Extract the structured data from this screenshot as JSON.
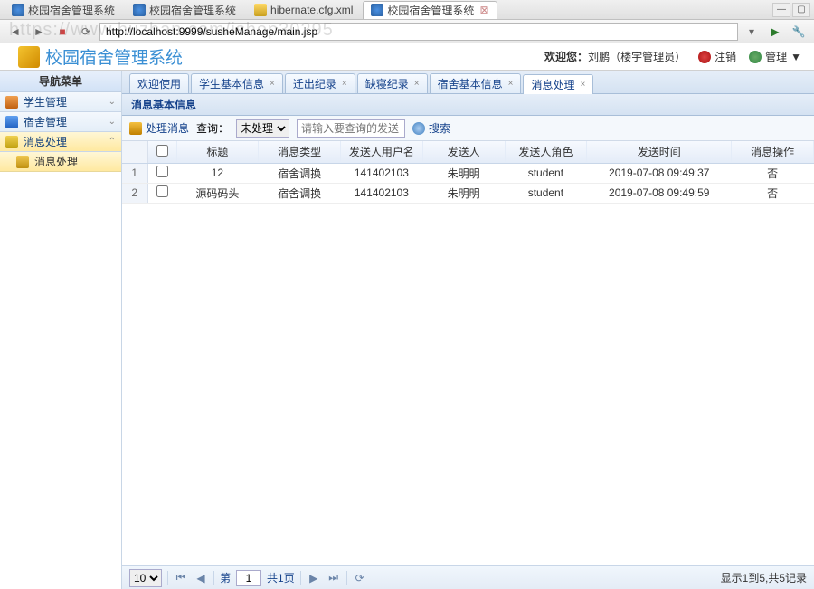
{
  "browser": {
    "tabs": [
      {
        "label": "校园宿舍管理系统",
        "icon": "globe",
        "active": false
      },
      {
        "label": "校园宿舍管理系统",
        "icon": "globe",
        "active": false
      },
      {
        "label": "hibernate.cfg.xml",
        "icon": "file",
        "active": false
      },
      {
        "label": "校园宿舍管理系统",
        "icon": "globe",
        "active": true
      }
    ],
    "address": "http://localhost:9999/susheManage/main.jsp",
    "watermark": "https://www.huzhan.com/ishop30295"
  },
  "header": {
    "app_title": "校园宿舍管理系统",
    "welcome_prefix": "欢迎您：",
    "welcome_user": "刘鹏（楼宇管理员）",
    "logout": "注销",
    "manage": "管理",
    "manage_dropdown": "▼"
  },
  "sidebar": {
    "title": "导航菜单",
    "items": [
      {
        "label": "学生管理",
        "icon": "stud",
        "active": false
      },
      {
        "label": "宿舍管理",
        "icon": "dorm",
        "active": false
      },
      {
        "label": "消息处理",
        "icon": "msg",
        "active": true
      }
    ],
    "subitem": {
      "label": "消息处理",
      "icon": "env"
    }
  },
  "tabs": [
    {
      "label": "欢迎使用",
      "closable": false,
      "active": false
    },
    {
      "label": "学生基本信息",
      "closable": true,
      "active": false
    },
    {
      "label": "迁出纪录",
      "closable": true,
      "active": false
    },
    {
      "label": "缺寝纪录",
      "closable": true,
      "active": false
    },
    {
      "label": "宿舍基本信息",
      "closable": true,
      "active": false
    },
    {
      "label": "消息处理",
      "closable": true,
      "active": true
    }
  ],
  "section": {
    "title": "消息基本信息"
  },
  "toolbar": {
    "process_label": "处理消息",
    "query_label": "查询：",
    "dropdown_value": "未处理",
    "search_placeholder": "请输入要查询的发送",
    "search_btn": "搜索"
  },
  "grid": {
    "columns": [
      "",
      "",
      "标题",
      "消息类型",
      "发送人用户名",
      "发送人",
      "发送人角色",
      "发送时间",
      "消息操作"
    ],
    "rows": [
      {
        "n": "1",
        "title": "12",
        "type": "宿舍调换",
        "username": "141402103",
        "sender": "朱明明",
        "role": "student",
        "time": "2019-07-08 09:49:37",
        "op": "否"
      },
      {
        "n": "2",
        "title": "源码码头",
        "type": "宿舍调换",
        "username": "141402103",
        "sender": "朱明明",
        "role": "student",
        "time": "2019-07-08 09:49:59",
        "op": "否"
      }
    ]
  },
  "pager": {
    "size": "10",
    "page_label_prefix": "第",
    "page": "1",
    "total_pages_label": "共1页",
    "info": "显示1到5,共5记录"
  }
}
